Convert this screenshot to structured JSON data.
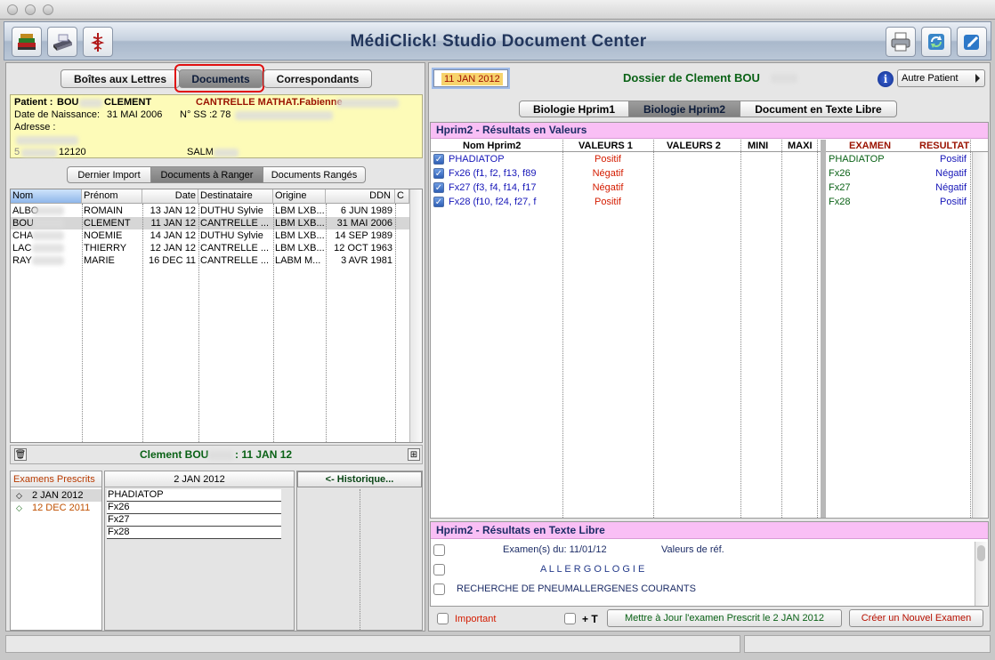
{
  "app": {
    "title": "MédiClick! Studio Document Center"
  },
  "toolbar": {
    "left_icons": [
      "books-icon",
      "scanner-icon",
      "caduceus-icon"
    ],
    "right_icons": [
      "printer-icon",
      "sync-icon",
      "edit-icon"
    ]
  },
  "left": {
    "tabs": [
      "Boîtes aux Lettres",
      "Documents",
      "Correspondants"
    ],
    "selected_tab": "Documents",
    "patient": {
      "patient_label": "Patient :",
      "last_name": "BOU",
      "first_name": "CLEMENT",
      "doctor": "CANTRELLE MATHAT.Fabienne",
      "dob_label": "Date de Naissance:",
      "dob": "31 MAI 2006",
      "ss_label": "N° SS :",
      "ss": "2 78",
      "address_label": "Adresse :",
      "line5_prefix": "5",
      "zip": "12120",
      "city": "SALM"
    },
    "subtabs": [
      "Dernier Import",
      "Documents à Ranger",
      "Documents Rangés"
    ],
    "selected_subtab": "Documents à Ranger",
    "columns": [
      "Nom",
      "Prénom",
      "Date",
      "Destinataire",
      "Origine",
      "DDN",
      "C"
    ],
    "rows": [
      {
        "nom": "ALBO",
        "prenom": "ROMAIN",
        "date": "13 JAN 12",
        "dest": "DUTHU Sylvie",
        "orig": "LBM LXB...",
        "ddn": "6 JUN 1989"
      },
      {
        "nom": "BOU",
        "prenom": "CLEMENT",
        "date": "11 JAN 12",
        "dest": "CANTRELLE ...",
        "orig": "LBM LXB...",
        "ddn": "31 MAI 2006"
      },
      {
        "nom": "CHA",
        "prenom": "NOEMIE",
        "date": "14 JAN 12",
        "dest": "DUTHU Sylvie",
        "orig": "LBM LXB...",
        "ddn": "14 SEP 1989"
      },
      {
        "nom": "LAC",
        "prenom": "THIERRY",
        "date": "12 JAN 12",
        "dest": "CANTRELLE ...",
        "orig": "LBM LXB...",
        "ddn": "12 OCT 1963"
      },
      {
        "nom": "RAY",
        "prenom": "MARIE",
        "date": "16 DEC 11",
        "dest": "CANTRELLE ...",
        "orig": "LABM M...",
        "ddn": "3 AVR 1981"
      }
    ],
    "selected_row": 1,
    "selection_name": "Clement BOU",
    "selection_date": ": 11 JAN 12",
    "exams": {
      "header": "Examens Prescrits",
      "items": [
        {
          "marker": "◇",
          "date": "2 JAN 2012",
          "selected": true
        },
        {
          "marker": "◇",
          "date": "12 DEC 2011",
          "selected": false
        }
      ],
      "detail_header": "2 JAN 2012",
      "detail_items": [
        "PHADIATOP",
        "Fx26",
        "Fx27",
        "Fx28"
      ],
      "history_button": "<- Historique..."
    }
  },
  "right": {
    "date": "11 JAN 2012",
    "dossier_label": "Dossier de Clement BOU",
    "info_icon": "info-icon",
    "other_patient": "Autre Patient",
    "tabs": [
      "Biologie Hprim1",
      "Biologie Hprim2",
      "Document en Texte Libre"
    ],
    "selected_tab": "Biologie Hprim2",
    "values_title": "Hprim2 - Résultats en Valeurs",
    "value_columns": [
      "Nom Hprim2",
      "VALEURS 1",
      "VALEURS 2",
      "MINI",
      "MAXI"
    ],
    "value_rows": [
      {
        "name": "PHADIATOP",
        "v1": "Positif"
      },
      {
        "name": "Fx26 (f1, f2, f13, f89",
        "v1": "Négatif"
      },
      {
        "name": "Fx27 (f3, f4, f14, f17",
        "v1": "Négatif"
      },
      {
        "name": "Fx28 (f10, f24, f27, f",
        "v1": "Positif"
      }
    ],
    "exam_columns": [
      "EXAMEN",
      "RESULTAT"
    ],
    "exam_rows": [
      {
        "examen": "PHADIATOP",
        "resultat": "Positif"
      },
      {
        "examen": "Fx26",
        "resultat": "Négatif"
      },
      {
        "examen": "Fx27",
        "resultat": "Négatif"
      },
      {
        "examen": "Fx28",
        "resultat": "Positif"
      }
    ],
    "text_title": "Hprim2 - Résultats en Texte Libre",
    "text_lines": [
      {
        "a": "Examen(s) du: 11/01/12",
        "b": "Valeurs de réf."
      },
      {
        "a": "A L L E R G O L O G I E",
        "b": ""
      },
      {
        "a": "RECHERCHE DE PNEUMALLERGENES COURANTS",
        "b": ""
      }
    ],
    "important_label": "Important",
    "plus_t_label": "+ T",
    "update_button": "Mettre à Jour l'examen Prescrit le 2 JAN 2012",
    "new_exam_button": "Créer un Nouvel Examen"
  },
  "colors": {
    "accent_red": "#d41c00",
    "accent_green": "#0a6216",
    "accent_blue": "#1616b8",
    "highlight_pink": "#f9bff5",
    "patient_yellow": "#fdfbb8"
  }
}
